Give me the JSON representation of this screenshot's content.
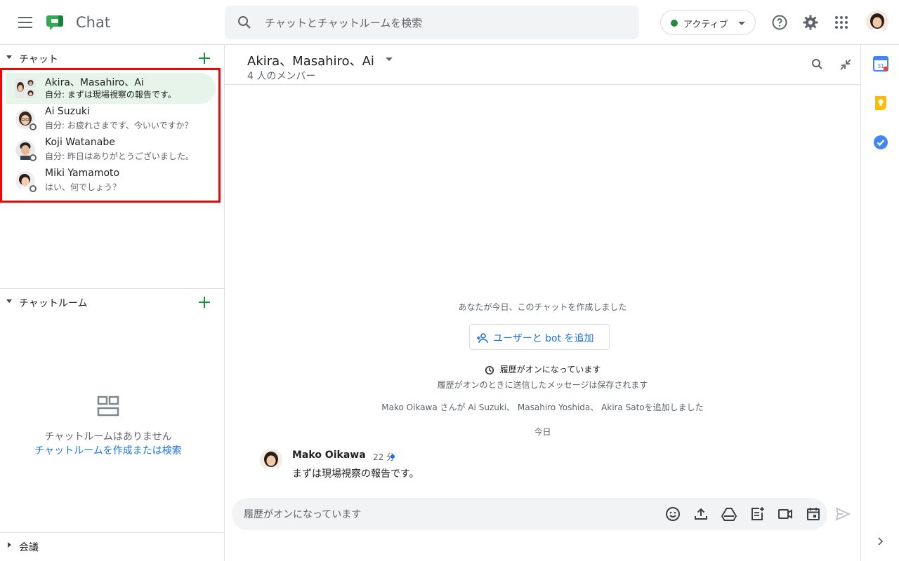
{
  "header": {
    "app_title": "Chat",
    "search_placeholder": "チャットとチャットルームを検索",
    "status_label": "アクティブ",
    "status_color": "#1e8e3e",
    "icons": [
      "menu-icon",
      "chat-logo-icon",
      "search-icon",
      "help-icon",
      "gear-icon",
      "apps-grid-icon"
    ]
  },
  "sidebar": {
    "chat_section_title": "チャット",
    "chats": [
      {
        "name": "Akira、Masahiro、Ai",
        "snippet": "自分: まずは現場視察の報告です。",
        "active": true
      },
      {
        "name": "Ai Suzuki",
        "snippet": "自分: お疲れさまです、今いいですか？",
        "active": false
      },
      {
        "name": "Koji Watanabe",
        "snippet": "自分: 昨日はありがとうございました。",
        "active": false
      },
      {
        "name": "Miki Yamamoto",
        "snippet": "はい、何でしょう？",
        "active": false
      }
    ],
    "rooms_section_title": "チャットルーム",
    "rooms_empty_text": "チャットルームはありません",
    "rooms_empty_link": "チャットルームを作成または検索",
    "meetings_section_title": "会議"
  },
  "conversation": {
    "title": "Akira、Masahiro、Ai",
    "subtitle": "4 人のメンバー",
    "created_notice": "あなたが今日、このチャットを作成しました",
    "add_button_label": "ユーザーと bot を追加",
    "history_on_title": "履歴がオンになっています",
    "history_on_desc": "履歴がオンのときに送信したメッセージは保存されます",
    "added_notice": "Mako Oikawa さんが Ai Suzuki、 Masahiro Yoshida、 Akira Satoを追加しました",
    "day_label": "今日",
    "message": {
      "author": "Mako Oikawa",
      "time": "22 分",
      "text": "まずは現場視察の報告です。"
    },
    "composer_placeholder": "履歴がオンになっています"
  },
  "colors": {
    "accent_green": "#1e8e3e",
    "link_blue": "#1a73e8",
    "active_chat_bg": "#e6f4ea",
    "highlight_border": "#ff0000"
  }
}
